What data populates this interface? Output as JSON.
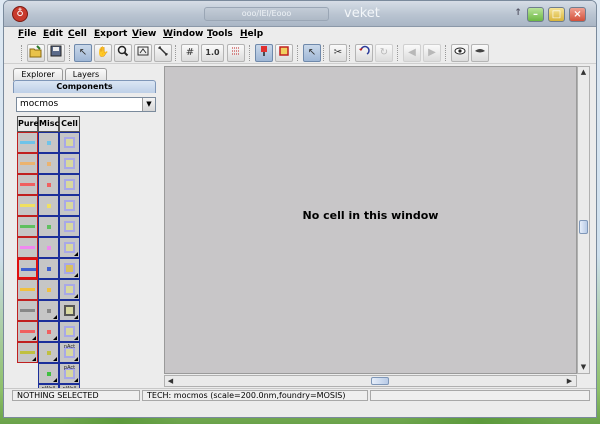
{
  "window": {
    "title_plate": "ooo/IEI/Eooo",
    "title": "veket",
    "app_icon_glyph": "♁"
  },
  "menu": [
    {
      "label": "File",
      "u": "F",
      "rest": "ile"
    },
    {
      "label": "Edit",
      "u": "E",
      "rest": "dit"
    },
    {
      "label": "Cell",
      "u": "C",
      "rest": "ell"
    },
    {
      "label": "Export",
      "u": "E",
      "rest": "xport"
    },
    {
      "label": "View",
      "u": "V",
      "rest": "iew"
    },
    {
      "label": "Window",
      "u": "W",
      "rest": "indow"
    },
    {
      "label": "Tools",
      "u": "T",
      "rest": "ools"
    },
    {
      "label": "Help",
      "u": "H",
      "rest": "elp"
    }
  ],
  "toolbar": {
    "open_icon": "open-folder-icon",
    "save_icon": "save-icon",
    "select_icon": "arrow-pointer-icon",
    "pan_icon": "hand-icon",
    "zoom_icon": "magnifier-icon",
    "outline_icon": "outline-icon",
    "measure_icon": "measure-icon",
    "grid_icon": "grid-icon",
    "grid_size": "1.0",
    "align_icon": "align-icon",
    "arc_mode_icon": "arc-mode-icon",
    "box_mode_icon": "box-mode-icon",
    "select_objects_icon": "select-objects-icon",
    "cut_icon": "scissors-icon",
    "undo_icon": "undo-icon",
    "redo_icon": "redo-icon",
    "back_icon": "back-arrow-icon",
    "forward_icon": "forward-arrow-icon",
    "show_icon": "eye-open-icon",
    "hide_icon": "eye-closed-icon"
  },
  "panel": {
    "tabs": [
      "Explorer",
      "Layers"
    ],
    "active_tab": "Components",
    "technology": "mocmos",
    "palette_headers": [
      "Pure",
      "Misc.",
      "Cell"
    ]
  },
  "palette_cells": {
    "col2_labels": [
      "",
      "",
      "",
      "",
      "",
      "",
      "",
      "",
      "",
      "",
      "nAct",
      "pAct",
      "nWell",
      "nWell"
    ],
    "col1_labels": [
      "",
      "",
      "",
      "",
      "",
      "",
      "",
      "",
      "",
      "",
      "",
      "",
      "pWell",
      "pPlus"
    ]
  },
  "canvas": {
    "message": "No cell in this window"
  },
  "status": {
    "selection": "NOTHING SELECTED",
    "tech": "TECH: mocmos (scale=200.0nm,foundry=MOSIS)"
  },
  "colors": {
    "canvas_bg": "#c8c6c8",
    "metal1": "#6fc3e9",
    "metal2": "#ebb36f",
    "poly": "#f06060",
    "pact": "#f0e060",
    "nact": "#60c060"
  }
}
